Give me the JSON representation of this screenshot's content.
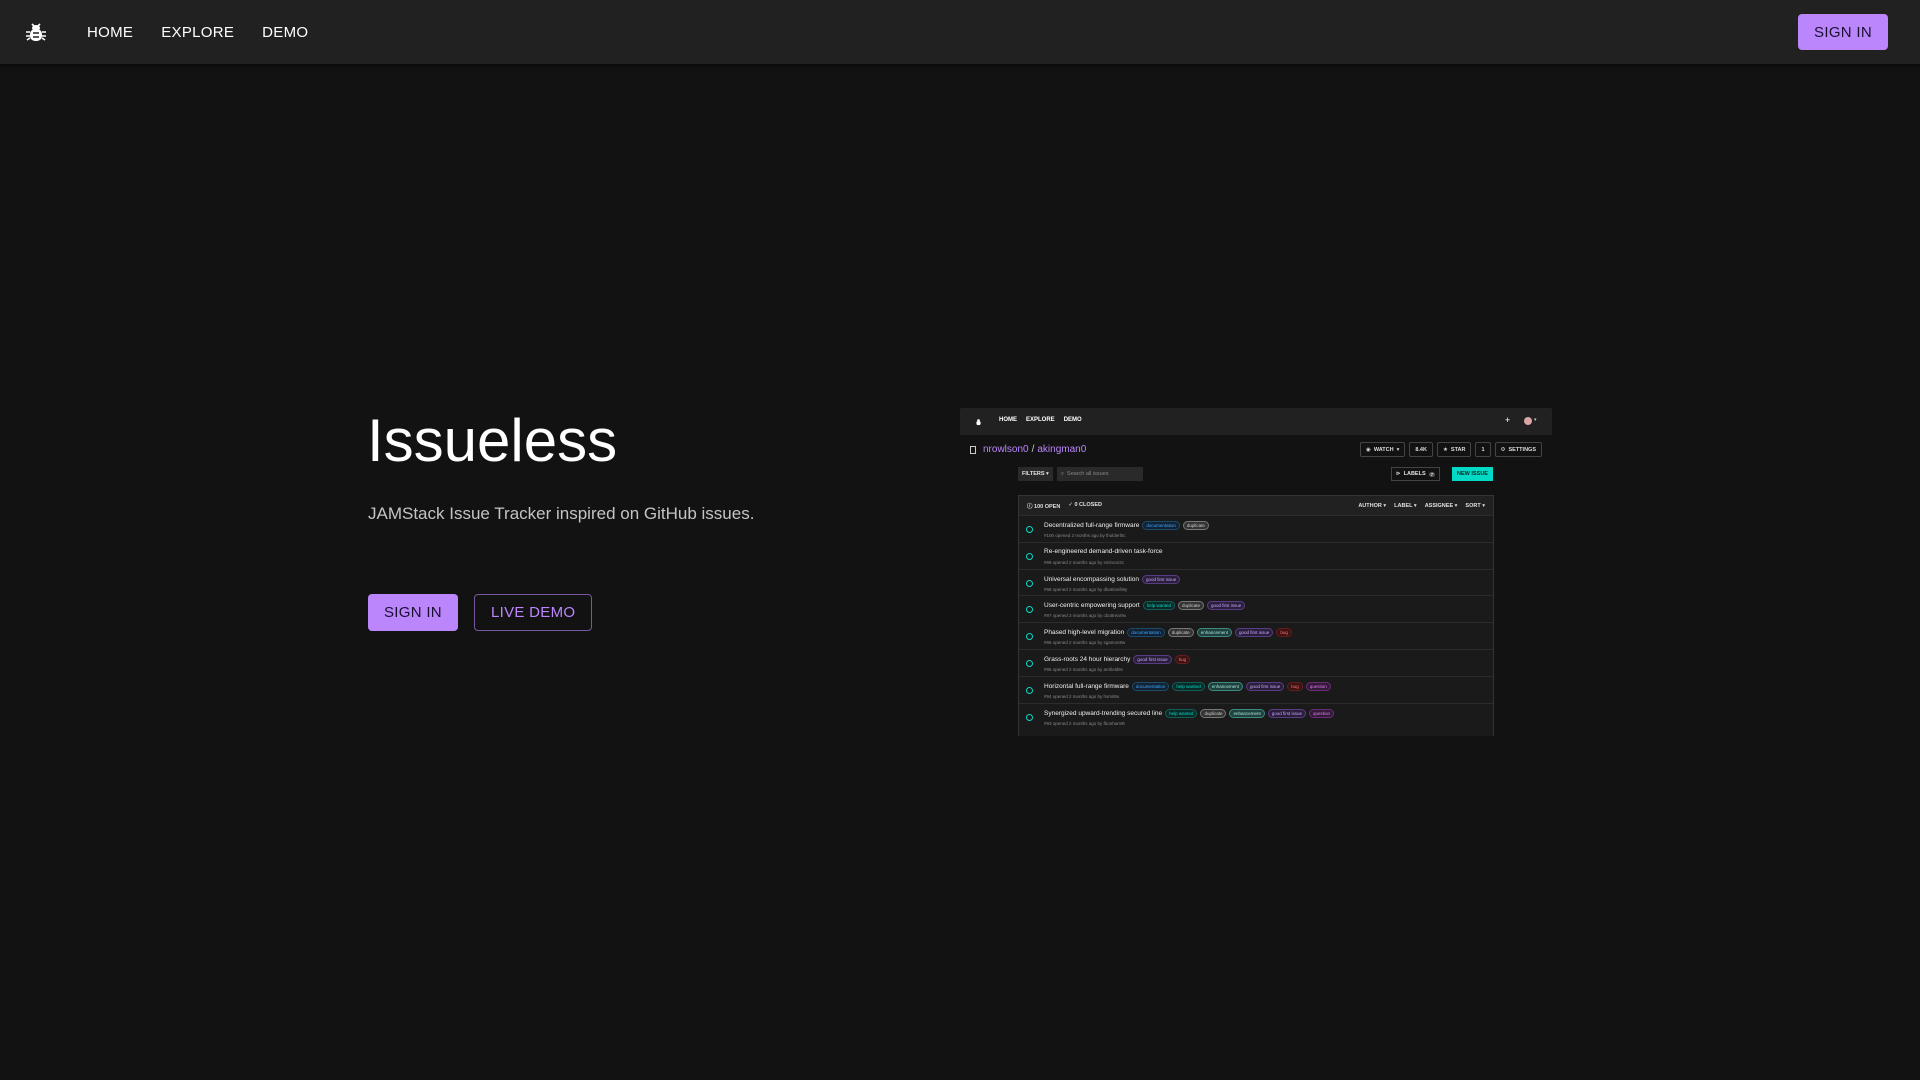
{
  "topbar": {
    "logo_icon": "bug-icon",
    "nav": [
      {
        "label": "HOME"
      },
      {
        "label": "EXPLORE"
      },
      {
        "label": "DEMO"
      }
    ],
    "signin_label": "SIGN IN",
    "accent": "#bb86fc"
  },
  "hero": {
    "title": "Issueless",
    "subtitle": "JAMStack Issue Tracker inspired on GitHub issues.",
    "signin_label": "SIGN IN",
    "demo_label": "LIVE DEMO"
  },
  "preview": {
    "nav": [
      "HOME",
      "EXPLORE",
      "DEMO"
    ],
    "owner": "nrowlson0",
    "separator": "/",
    "repo": "akingman0",
    "watch_label": "WATCH",
    "watch_count": "8.4K",
    "star_label": "STAR",
    "star_count": "1",
    "settings_label": "SETTINGS",
    "filters_label": "FILTERS",
    "search_placeholder": "Search all issues",
    "labels_label": "LABELS",
    "labels_count": "7",
    "new_issue_label": "NEW ISSUE",
    "open_label": "100 OPEN",
    "closed_label": "0 CLOSED",
    "sort_labels": [
      "AUTHOR",
      "LABEL",
      "ASSIGNEE",
      "SORT"
    ],
    "issues": [
      {
        "title": "Decentralized full-range firmware",
        "meta": "#100 opened 2 months ago by tholderl0c",
        "labels": [
          "documentation",
          "duplicate"
        ]
      },
      {
        "title": "Re-engineered demand-driven task-force",
        "meta": "#99 opened 2 months ago by smincar2c",
        "labels": []
      },
      {
        "title": "Universal encompassing solution",
        "meta": "#98 opened 2 months ago by dbottinelli9y",
        "labels": [
          "good first issue"
        ]
      },
      {
        "title": "User-centric empowering support",
        "meta": "#97 opened 2 months ago by cbottrear9x",
        "labels": [
          "help wanted",
          "duplicate",
          "good first issue"
        ]
      },
      {
        "title": "Phased high-level migration",
        "meta": "#96 opened 2 months ago by sgamon9w",
        "labels": [
          "documentation",
          "duplicate",
          "enhancement",
          "good first issue",
          "bug"
        ]
      },
      {
        "title": "Grass-roots 24 hour hierarchy",
        "meta": "#95 opened 2 months ago by arnfield9v",
        "labels": [
          "good first issue",
          "bug"
        ]
      },
      {
        "title": "Horizontal full-range firmware",
        "meta": "#94 opened 2 months ago by hsmit9u",
        "labels": [
          "documentation",
          "help wanted",
          "enhancement",
          "good first issue",
          "bug",
          "question"
        ]
      },
      {
        "title": "Synergized upward-trending secured line",
        "meta": "#93 opened 2 months ago by fbonham9t",
        "labels": [
          "help wanted",
          "duplicate",
          "enhancement",
          "good first issue",
          "question"
        ]
      }
    ]
  }
}
